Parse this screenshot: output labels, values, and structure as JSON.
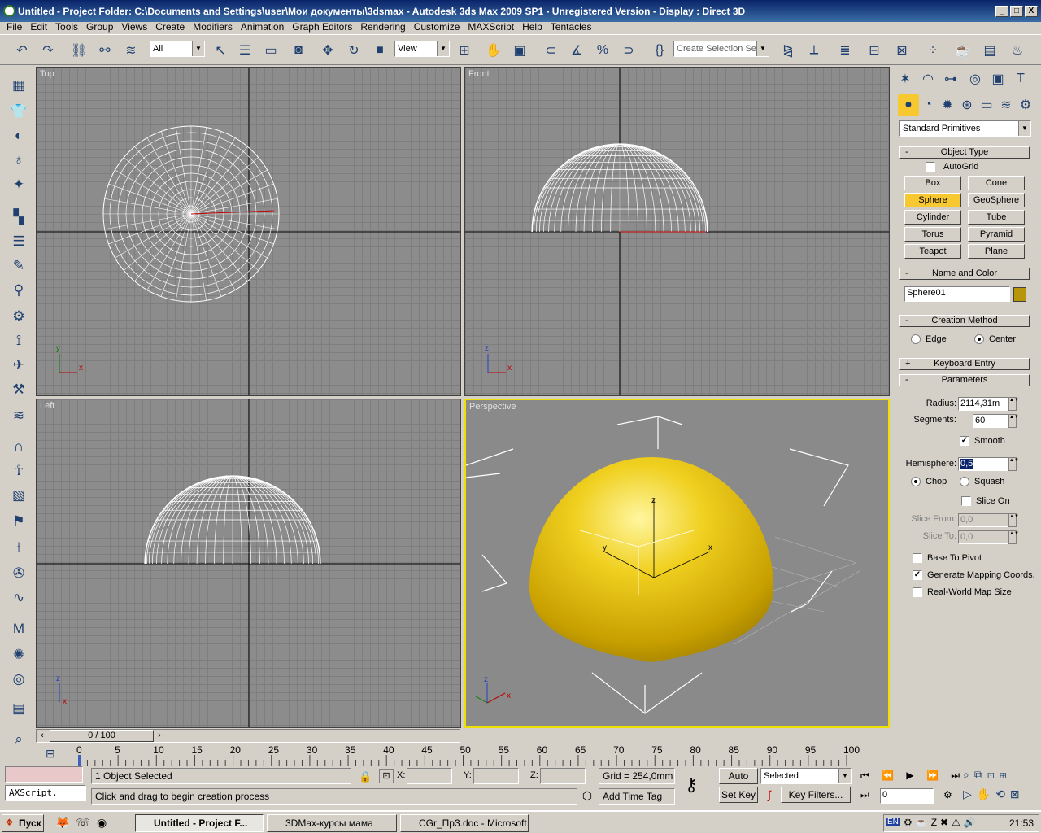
{
  "title": {
    "text": "Untitled      - Project Folder: C:\\Documents and Settings\\user\\Мои документы\\3dsmax      - Autodesk 3ds Max  2009 SP1   - Unregistered Version      - Display : Direct 3D",
    "minimize": "_",
    "maximize": "□",
    "close": "X"
  },
  "menu": [
    "File",
    "Edit",
    "Tools",
    "Group",
    "Views",
    "Create",
    "Modifiers",
    "Animation",
    "Graph Editors",
    "Rendering",
    "Customize",
    "MAXScript",
    "Help",
    "Tentacles"
  ],
  "toolbar": {
    "filter": "All",
    "refcoord": "View",
    "selection_set": "Create Selection Set"
  },
  "viewports": {
    "top": "Top",
    "front": "Front",
    "left": "Left",
    "perspective": "Perspective",
    "axis_x": "x",
    "axis_y": "y",
    "axis_z": "z"
  },
  "panel": {
    "category": "Standard Primitives",
    "object_type": {
      "title": "Object Type",
      "autogrid": "AutoGrid",
      "buttons": [
        "Box",
        "Cone",
        "Sphere",
        "GeoSphere",
        "Cylinder",
        "Tube",
        "Torus",
        "Pyramid",
        "Teapot",
        "Plane"
      ],
      "active": "Sphere"
    },
    "name_color": {
      "title": "Name and Color",
      "name": "Sphere01",
      "color": "#b8960c"
    },
    "creation_method": {
      "title": "Creation Method",
      "edge": "Edge",
      "center": "Center"
    },
    "keyboard_entry": "Keyboard Entry",
    "parameters": {
      "title": "Parameters",
      "radius_label": "Radius:",
      "radius": "2114,31m",
      "segments_label": "Segments:",
      "segments": "60",
      "smooth": "Smooth",
      "hemisphere_label": "Hemisphere:",
      "hemisphere": "0,5",
      "chop": "Chop",
      "squash": "Squash",
      "slice_on": "Slice On",
      "slice_from_label": "Slice From:",
      "slice_from": "0,0",
      "slice_to_label": "Slice To:",
      "slice_to": "0,0",
      "base_to_pivot": "Base To Pivot",
      "gen_mapping": "Generate Mapping Coords.",
      "real_world": "Real-World Map Size"
    },
    "collapse": "-",
    "expand": "+"
  },
  "timeline": {
    "slider": "0 / 100",
    "ticks": [
      "0",
      "5",
      "10",
      "15",
      "20",
      "25",
      "30",
      "35",
      "40",
      "45",
      "50",
      "55",
      "60",
      "65",
      "70",
      "75",
      "80",
      "85",
      "90",
      "95",
      "100"
    ]
  },
  "status": {
    "listener": "AXScript.",
    "selected": "1 Object Selected",
    "prompt": "Click and drag to begin creation process",
    "x_label": "X:",
    "y_label": "Y:",
    "z_label": "Z:",
    "grid": "Grid = 254,0mm",
    "add_time_tag": "Add Time Tag",
    "auto_key": "Auto Key",
    "set_key": "Set Key",
    "selected_mode": "Selected",
    "key_filters": "Key Filters...",
    "frame": "0"
  },
  "taskbar": {
    "start": "Пуск",
    "tasks": [
      "Untitled      - Project F...",
      "3DMax-курсы мама",
      "CGr_Пр3.doc - Microsoft..."
    ],
    "lang": "EN",
    "clock": "21:53"
  }
}
